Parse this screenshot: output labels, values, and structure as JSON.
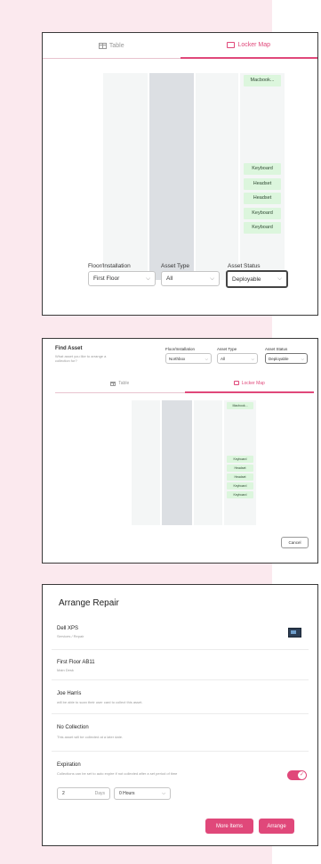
{
  "card1": {
    "tabs": [
      {
        "label": "Table",
        "icon": "table-icon",
        "active": false
      },
      {
        "label": "Locker Map",
        "icon": "locker-map-icon",
        "active": true
      }
    ],
    "left_col": [
      "",
      "",
      "",
      "",
      "",
      "",
      "",
      "",
      "",
      "",
      "",
      "",
      "",
      ""
    ],
    "right_col": [
      "",
      "",
      "",
      "",
      "",
      "",
      "",
      "",
      "",
      "",
      "",
      "",
      "",
      ""
    ],
    "tags": [
      "Macbook...",
      "Keyboard",
      "Headset",
      "Headset",
      "Keyboard",
      "Keyboard"
    ],
    "filters": [
      {
        "label": "Floor/Installation",
        "value": "First Floor"
      },
      {
        "label": "Asset Type",
        "value": "All"
      },
      {
        "label": "Asset Status",
        "value": "Deployable"
      }
    ]
  },
  "card2": {
    "title": "Find Asset",
    "subtitle": "What asset you like to arrange a collection for?",
    "filters": [
      {
        "label": "Floor/Installation",
        "value": "Northbox"
      },
      {
        "label": "Asset Type",
        "value": "All"
      },
      {
        "label": "Asset Status",
        "value": "Deployable"
      }
    ],
    "tabs": [
      {
        "label": "Table",
        "icon": "table-icon",
        "active": false
      },
      {
        "label": "Locker Map",
        "icon": "locker-map-icon",
        "active": true
      }
    ],
    "tags": [
      "Macbook...",
      "Keyboard",
      "Headset",
      "Headset",
      "Keyboard",
      "Keyboard"
    ],
    "cancel_label": "Cancel"
  },
  "card3": {
    "title": "Arrange Repair",
    "rows": [
      {
        "title": "Dell XPS",
        "sub": "Services / Repair"
      },
      {
        "title": "First Floor AB11",
        "sub": "Main Desk"
      },
      {
        "title": "Joe Harris",
        "sub": "will be able to scan their user card to collect this asset."
      },
      {
        "title": "No Collection",
        "sub": "This asset will be collected at a later date."
      },
      {
        "title": "Expiration",
        "sub": "Collections can be set to auto expire if not collected after a set period of time"
      }
    ],
    "days_value": "2",
    "days_label": "Days",
    "hours_value": "0 Hours",
    "more_label": "More Items",
    "arrange_label": "Arrange",
    "toggle_on": true
  },
  "colors": {
    "accent": "#e0487a",
    "tag_bg": "#dcf6dd",
    "bg_panel": "#fbe9ee"
  }
}
